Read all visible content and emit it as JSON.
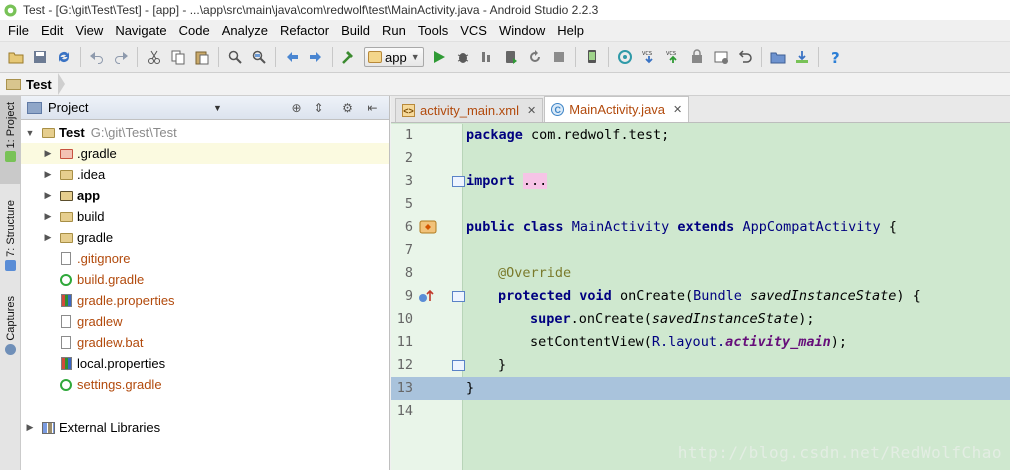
{
  "window": {
    "title": "Test - [G:\\git\\Test\\Test] - [app] - ...\\app\\src\\main\\java\\com\\redwolf\\test\\MainActivity.java - Android Studio 2.2.3"
  },
  "menu": [
    "File",
    "Edit",
    "View",
    "Navigate",
    "Code",
    "Analyze",
    "Refactor",
    "Build",
    "Run",
    "Tools",
    "VCS",
    "Window",
    "Help"
  ],
  "toolbar": {
    "run_config": "app",
    "icons": [
      "open-icon",
      "save-all-icon",
      "sync-icon",
      "undo-icon",
      "redo-icon",
      "cut-icon",
      "copy-icon",
      "paste-icon",
      "find-icon",
      "replace-icon",
      "back-icon",
      "forward-icon",
      "make-project-icon",
      "run-icon",
      "debug-icon",
      "profile-icon",
      "apply-changes-icon",
      "restart-icon",
      "stop-icon",
      "avd-manager-icon",
      "sync-gradle-icon",
      "vcs-update-icon",
      "vcs-commit-icon",
      "vcs-push-icon",
      "settings-icon",
      "revert-icon",
      "project-structure-icon",
      "sdk-manager-icon",
      "help-icon"
    ]
  },
  "breadcrumb": {
    "root": "Test"
  },
  "left_stripe": {
    "tabs": [
      "1: Project",
      "7: Structure",
      "Captures"
    ]
  },
  "project_panel": {
    "header": "Project",
    "root": {
      "name": "Test",
      "path": "G:\\git\\Test\\Test"
    },
    "items": [
      {
        "name": ".gradle",
        "kind": "folder-excluded",
        "expandable": true
      },
      {
        "name": ".idea",
        "kind": "folder",
        "expandable": true
      },
      {
        "name": "app",
        "kind": "module",
        "expandable": true
      },
      {
        "name": "build",
        "kind": "folder",
        "expandable": true
      },
      {
        "name": "gradle",
        "kind": "folder",
        "expandable": true
      },
      {
        "name": ".gitignore",
        "kind": "file",
        "expandable": false
      },
      {
        "name": "build.gradle",
        "kind": "gradle",
        "expandable": false
      },
      {
        "name": "gradle.properties",
        "kind": "properties",
        "expandable": false
      },
      {
        "name": "gradlew",
        "kind": "file",
        "expandable": false
      },
      {
        "name": "gradlew.bat",
        "kind": "file",
        "expandable": false
      },
      {
        "name": "local.properties",
        "kind": "properties",
        "expandable": false
      },
      {
        "name": "settings.gradle",
        "kind": "gradle",
        "expandable": false
      }
    ],
    "external": "External Libraries"
  },
  "editor": {
    "tabs": [
      {
        "label": "activity_main.xml",
        "active": false
      },
      {
        "label": "MainActivity.java",
        "active": true
      }
    ],
    "line_numbers": [
      "1",
      "2",
      "3",
      "5",
      "6",
      "7",
      "8",
      "9",
      "10",
      "11",
      "12",
      "13",
      "14"
    ],
    "code": {
      "l1_kw": "package",
      "l1_rest": " com.redwolf.test;",
      "l3_kw": "import",
      "l3_rest": "...",
      "l6_kw1": "public",
      "l6_kw2": "class",
      "l6_cls": "MainActivity",
      "l6_kw3": "extends",
      "l6_parent": "AppCompatActivity",
      "l6_brace": "{",
      "l8_ann": "@Override",
      "l9_kw1": "protected",
      "l9_kw2": "void",
      "l9_meth": "onCreate",
      "l9_type": "Bundle",
      "l9_param": "savedInstanceState",
      "l9_end": ") {",
      "l10_kw": "super",
      "l10_meth": ".onCreate(",
      "l10_param": "savedInstanceState",
      "l10_end": ");",
      "l11_meth": "setContentView(",
      "l11_r": "R.layout.",
      "l11_fld": "activity_main",
      "l11_end": ");",
      "l12": "}",
      "l13": "}"
    },
    "watermark": "http://blog.csdn.net/RedWolfChao"
  }
}
